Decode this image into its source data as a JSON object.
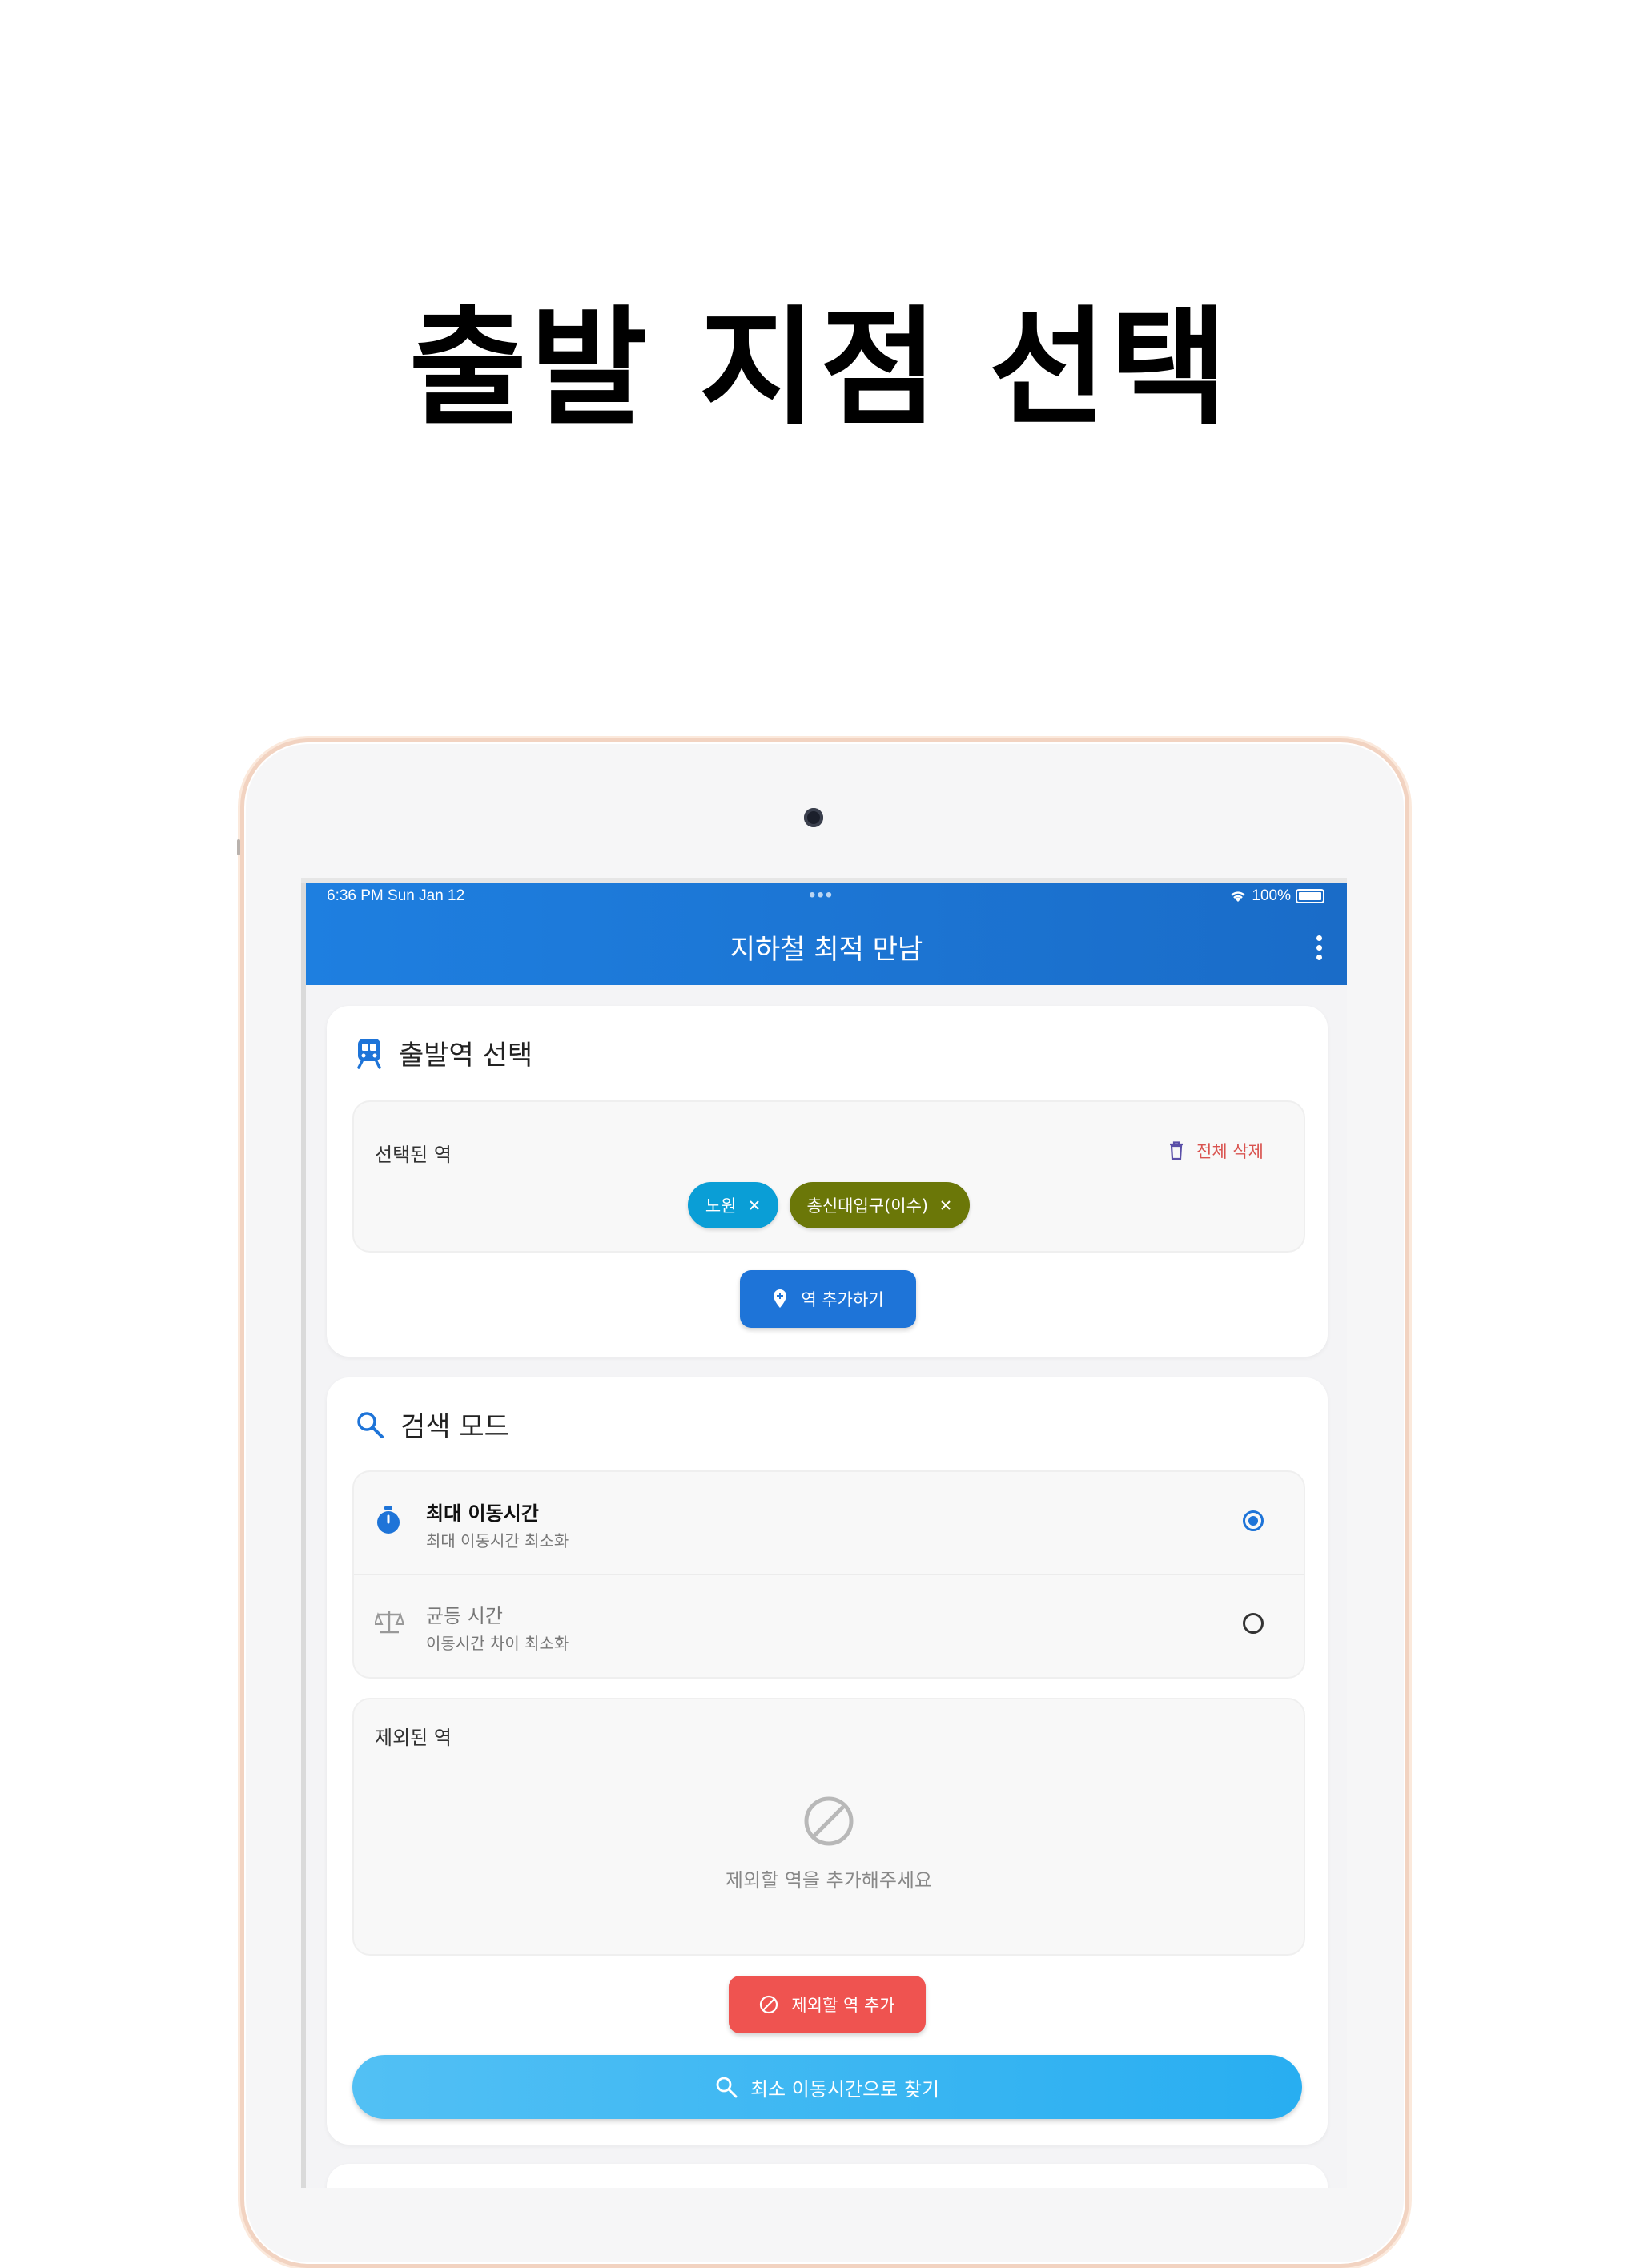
{
  "headline": "출발 지점 선택",
  "status_bar": {
    "time": "6:36 PM   Sun Jan 12",
    "dots": "•••",
    "battery": "100%"
  },
  "appbar": {
    "title": "지하철 최적 만남"
  },
  "departure_card": {
    "title": "출발역 선택",
    "selected_label": "선택된 역",
    "delete_all_label": "전체 삭제",
    "stations": [
      {
        "name": "노원",
        "color": "#0a9ed6"
      },
      {
        "name": "총신대입구(이수)",
        "color": "#6b7708"
      }
    ],
    "add_button_label": "역 추가하기"
  },
  "search_card": {
    "title": "검색 모드",
    "modes": [
      {
        "title": "최대 이동시간",
        "subtitle": "최대 이동시간 최소화",
        "selected": true
      },
      {
        "title": "균등 시간",
        "subtitle": "이동시간 차이 최소화",
        "selected": false
      }
    ],
    "excluded_label": "제외된 역",
    "excluded_empty": "제외할 역을 추가해주세요",
    "exclude_button_label": "제외할 역 추가",
    "search_button_label": "최소 이동시간으로 찾기"
  },
  "colors": {
    "primary": "#1e7fe0",
    "danger": "#ef5350",
    "search_gradient": "#4fc3f7"
  }
}
